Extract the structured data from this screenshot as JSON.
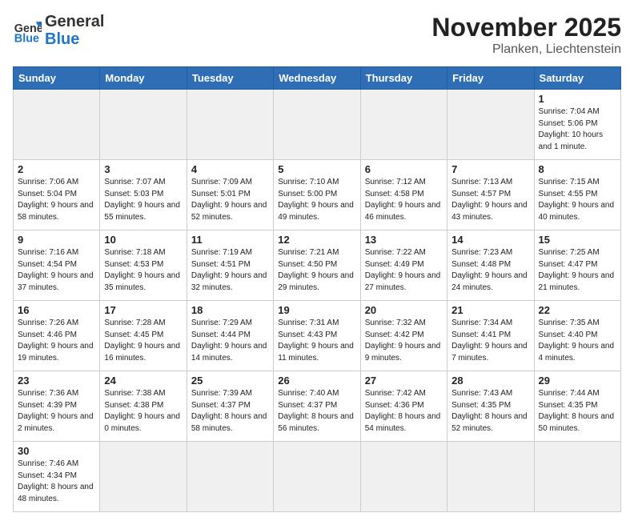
{
  "logo": {
    "general": "General",
    "blue": "Blue"
  },
  "header": {
    "month": "November 2025",
    "location": "Planken, Liechtenstein"
  },
  "weekdays": [
    "Sunday",
    "Monday",
    "Tuesday",
    "Wednesday",
    "Thursday",
    "Friday",
    "Saturday"
  ],
  "weeks": [
    [
      {
        "day": "",
        "info": ""
      },
      {
        "day": "",
        "info": ""
      },
      {
        "day": "",
        "info": ""
      },
      {
        "day": "",
        "info": ""
      },
      {
        "day": "",
        "info": ""
      },
      {
        "day": "",
        "info": ""
      },
      {
        "day": "1",
        "info": "Sunrise: 7:04 AM\nSunset: 5:06 PM\nDaylight: 10 hours and 1 minute."
      }
    ],
    [
      {
        "day": "2",
        "info": "Sunrise: 7:06 AM\nSunset: 5:04 PM\nDaylight: 9 hours and 58 minutes."
      },
      {
        "day": "3",
        "info": "Sunrise: 7:07 AM\nSunset: 5:03 PM\nDaylight: 9 hours and 55 minutes."
      },
      {
        "day": "4",
        "info": "Sunrise: 7:09 AM\nSunset: 5:01 PM\nDaylight: 9 hours and 52 minutes."
      },
      {
        "day": "5",
        "info": "Sunrise: 7:10 AM\nSunset: 5:00 PM\nDaylight: 9 hours and 49 minutes."
      },
      {
        "day": "6",
        "info": "Sunrise: 7:12 AM\nSunset: 4:58 PM\nDaylight: 9 hours and 46 minutes."
      },
      {
        "day": "7",
        "info": "Sunrise: 7:13 AM\nSunset: 4:57 PM\nDaylight: 9 hours and 43 minutes."
      },
      {
        "day": "8",
        "info": "Sunrise: 7:15 AM\nSunset: 4:55 PM\nDaylight: 9 hours and 40 minutes."
      }
    ],
    [
      {
        "day": "9",
        "info": "Sunrise: 7:16 AM\nSunset: 4:54 PM\nDaylight: 9 hours and 37 minutes."
      },
      {
        "day": "10",
        "info": "Sunrise: 7:18 AM\nSunset: 4:53 PM\nDaylight: 9 hours and 35 minutes."
      },
      {
        "day": "11",
        "info": "Sunrise: 7:19 AM\nSunset: 4:51 PM\nDaylight: 9 hours and 32 minutes."
      },
      {
        "day": "12",
        "info": "Sunrise: 7:21 AM\nSunset: 4:50 PM\nDaylight: 9 hours and 29 minutes."
      },
      {
        "day": "13",
        "info": "Sunrise: 7:22 AM\nSunset: 4:49 PM\nDaylight: 9 hours and 27 minutes."
      },
      {
        "day": "14",
        "info": "Sunrise: 7:23 AM\nSunset: 4:48 PM\nDaylight: 9 hours and 24 minutes."
      },
      {
        "day": "15",
        "info": "Sunrise: 7:25 AM\nSunset: 4:47 PM\nDaylight: 9 hours and 21 minutes."
      }
    ],
    [
      {
        "day": "16",
        "info": "Sunrise: 7:26 AM\nSunset: 4:46 PM\nDaylight: 9 hours and 19 minutes."
      },
      {
        "day": "17",
        "info": "Sunrise: 7:28 AM\nSunset: 4:45 PM\nDaylight: 9 hours and 16 minutes."
      },
      {
        "day": "18",
        "info": "Sunrise: 7:29 AM\nSunset: 4:44 PM\nDaylight: 9 hours and 14 minutes."
      },
      {
        "day": "19",
        "info": "Sunrise: 7:31 AM\nSunset: 4:43 PM\nDaylight: 9 hours and 11 minutes."
      },
      {
        "day": "20",
        "info": "Sunrise: 7:32 AM\nSunset: 4:42 PM\nDaylight: 9 hours and 9 minutes."
      },
      {
        "day": "21",
        "info": "Sunrise: 7:34 AM\nSunset: 4:41 PM\nDaylight: 9 hours and 7 minutes."
      },
      {
        "day": "22",
        "info": "Sunrise: 7:35 AM\nSunset: 4:40 PM\nDaylight: 9 hours and 4 minutes."
      }
    ],
    [
      {
        "day": "23",
        "info": "Sunrise: 7:36 AM\nSunset: 4:39 PM\nDaylight: 9 hours and 2 minutes."
      },
      {
        "day": "24",
        "info": "Sunrise: 7:38 AM\nSunset: 4:38 PM\nDaylight: 9 hours and 0 minutes."
      },
      {
        "day": "25",
        "info": "Sunrise: 7:39 AM\nSunset: 4:37 PM\nDaylight: 8 hours and 58 minutes."
      },
      {
        "day": "26",
        "info": "Sunrise: 7:40 AM\nSunset: 4:37 PM\nDaylight: 8 hours and 56 minutes."
      },
      {
        "day": "27",
        "info": "Sunrise: 7:42 AM\nSunset: 4:36 PM\nDaylight: 8 hours and 54 minutes."
      },
      {
        "day": "28",
        "info": "Sunrise: 7:43 AM\nSunset: 4:35 PM\nDaylight: 8 hours and 52 minutes."
      },
      {
        "day": "29",
        "info": "Sunrise: 7:44 AM\nSunset: 4:35 PM\nDaylight: 8 hours and 50 minutes."
      }
    ],
    [
      {
        "day": "30",
        "info": "Sunrise: 7:46 AM\nSunset: 4:34 PM\nDaylight: 8 hours and 48 minutes."
      },
      {
        "day": "",
        "info": ""
      },
      {
        "day": "",
        "info": ""
      },
      {
        "day": "",
        "info": ""
      },
      {
        "day": "",
        "info": ""
      },
      {
        "day": "",
        "info": ""
      },
      {
        "day": "",
        "info": ""
      }
    ]
  ]
}
